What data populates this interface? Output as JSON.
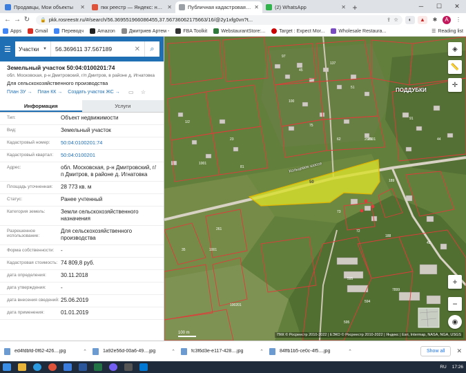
{
  "browser": {
    "tabs": [
      {
        "label": "Продавцы, Мои объекты",
        "color": "#3b7ddd"
      },
      {
        "label": "пкк реестр — Яндекс: нашлось",
        "color": "#e0533b"
      },
      {
        "label": "Публичная кадастровая карта",
        "color": "#f0f0f0"
      },
      {
        "label": "(2) WhatsApp",
        "color": "#2fb34a"
      }
    ],
    "url": "pkk.rosreestr.ru/#/search/56.369551966086455,37.56736062175663/16/@2y1xfg0vn?t...",
    "bookmarks": [
      {
        "label": "Apps",
        "color": "#4285f4"
      },
      {
        "label": "Gmail",
        "color": "#d93025"
      },
      {
        "label": "Переводч",
        "color": "#4285f4"
      },
      {
        "label": "Amazon",
        "color": "#222222"
      },
      {
        "label": "Дмитриев Артем -",
        "color": "#8a8a8a"
      },
      {
        "label": "FBA Toolkit",
        "color": "#333333"
      },
      {
        "label": "WebstaurantStore:...",
        "color": "#2d7a3a"
      },
      {
        "label": "Target : Expect Mor...",
        "color": "#cc0000"
      },
      {
        "label": "Wholesale Restaura...",
        "color": "#7a4cc1"
      }
    ],
    "reading_list": "Reading list"
  },
  "panel": {
    "search_type": "Участки",
    "search_value": "56.369611 37.567189",
    "title": "Земельный участок 50:04:0100201:74",
    "address": "обл. Московская, р-н Дмитровский, г/п Дмитров, в районе д. Игнатовка",
    "use": "Для сельскохозяйственного производства",
    "links": [
      "План ЗУ →",
      "План КК →",
      "Создать участок ЖС →"
    ],
    "tab_info": "Информация",
    "tab_services": "Услуги",
    "rows": [
      {
        "k": "Тип:",
        "v": "Объект недвижимости"
      },
      {
        "k": "Вид:",
        "v": "Земельный участок"
      },
      {
        "k": "Кадастровый номер:",
        "v": "50:04:0100201:74",
        "link": true
      },
      {
        "k": "Кадастровый квартал:",
        "v": "50:04:0100201",
        "link": true
      },
      {
        "k": "Адрес:",
        "v": "обл. Московская, р-н Дмитровский, г/п Дмитров, в районе д. Игнатовка"
      },
      {
        "k": "Площадь уточненная:",
        "v": "28 773 кв. м"
      },
      {
        "k": "Статус:",
        "v": "Ранее учтенный"
      },
      {
        "k": "Категория земель:",
        "v": "Земли сельскохозяйственного назначения"
      },
      {
        "k": "Разрешенное использование:",
        "v": "Для сельскохозяйственного производства"
      },
      {
        "k": "Форма собственности:",
        "v": "-"
      },
      {
        "k": "Кадастровая стоимость:",
        "v": "74 809,8 руб."
      },
      {
        "k": "дата определения:",
        "v": "30.11.2018"
      },
      {
        "k": "дата утверждения:",
        "v": "-"
      },
      {
        "k": "дата внесения сведений:",
        "v": "25.06.2019"
      },
      {
        "k": "дата применения:",
        "v": "01.01.2019"
      }
    ]
  },
  "map": {
    "village": "ПОДДУБКИ",
    "road": "Кольцевое шоссе",
    "parcel_label": "50",
    "scale": "100 m",
    "copyright": "ПКК © Росреестр 2010-2022 | ЕЭКО © Росреестр 2010-2022 | Яндекс | Esri, Intermap, NASA, NGA, USGS",
    "zoom_in": "+",
    "zoom_out": "−"
  },
  "downloads": {
    "items": [
      "ed4fdbfd-0f62-426....jpg",
      "1a92e56d-00a6-49....jpg",
      "fc3f6d3e-e117-428....jpg",
      "84ffb1b5-ce0c-4f5....jpg"
    ],
    "show_all": "Show all"
  },
  "taskbar": {
    "lang": "RU",
    "time": "17:26"
  }
}
